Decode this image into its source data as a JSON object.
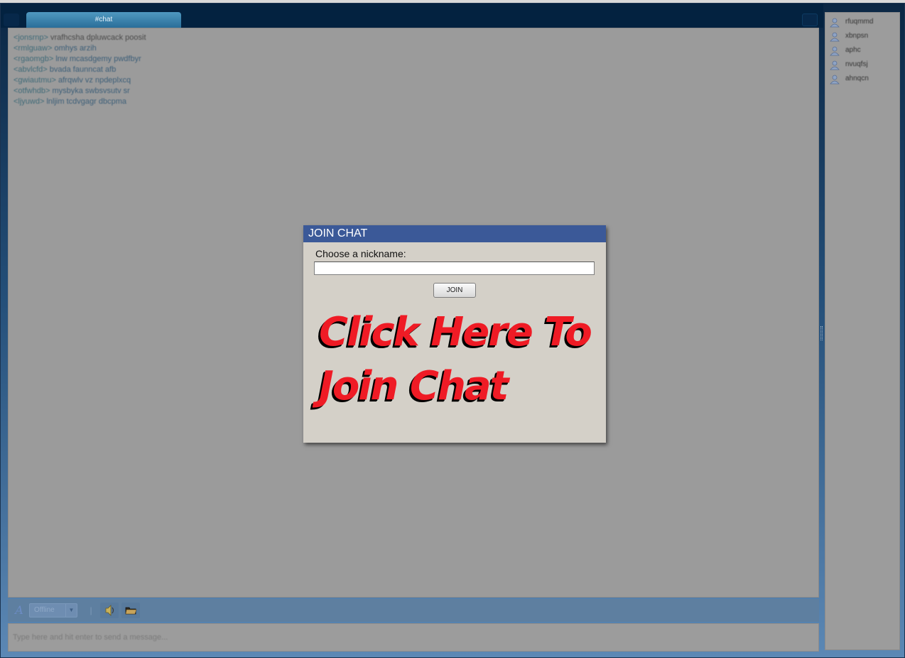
{
  "window": {
    "tab_label": "#chat"
  },
  "chat": {
    "messages": [
      {
        "nick": "<jonsrnp>",
        "text": "vrafhcsha dpluwcack poosit"
      },
      {
        "nick": "<rmlguaw>",
        "text": "omhys arzih"
      },
      {
        "nick": "<rgaomgb>",
        "text": "lnw mcasdgemy pwdfbyr"
      },
      {
        "nick": "<abvlcfd>",
        "text": "bvada faunncat afb"
      },
      {
        "nick": "<gwiautmu>",
        "text": "afrqwlv vz npdeplxcq"
      },
      {
        "nick": "<otfwhdb>",
        "text": "mysbyka swbsvsutv sr"
      },
      {
        "nick": "<ljyuwd>",
        "text": "lnljim tcdvgagr dbcpma"
      }
    ]
  },
  "users": [
    "rfuqmmd",
    "xbnpsn",
    "aphc",
    "nvuqfsj",
    "ahnqcn"
  ],
  "toolbar": {
    "status_label": "Offline",
    "separator": "|"
  },
  "message_input": {
    "placeholder": "Type here and hit enter to send a message..."
  },
  "modal": {
    "title": "JOIN CHAT",
    "nickname_label": "Choose a nickname:",
    "nickname_value": "",
    "join_label": "JOIN",
    "promo_line1": "Click Here To",
    "promo_line2": "Join Chat"
  },
  "colors": {
    "modal_header": "#3b5998",
    "promo_red": "#ef1b25",
    "chat_background": "#9b9b9b"
  }
}
